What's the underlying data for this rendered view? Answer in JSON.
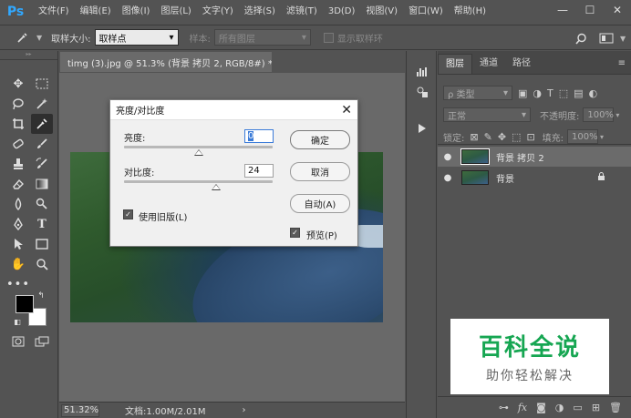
{
  "app": {
    "logo": "Ps",
    "menu": [
      "文件(F)",
      "编辑(E)",
      "图像(I)",
      "图层(L)",
      "文字(Y)",
      "选择(S)",
      "滤镜(T)",
      "3D(D)",
      "视图(V)",
      "窗口(W)",
      "帮助(H)"
    ],
    "window_controls": [
      "—",
      "☐",
      "✕"
    ]
  },
  "options_bar": {
    "sample_size_label": "取样大小:",
    "sample_size_value": "取样点",
    "sample_label": "样本:",
    "sample_value": "所有图层",
    "show_ring_label": "显示取样环"
  },
  "document": {
    "tab_title": "timg (3).jpg @ 51.3% (背景 拷贝 2, RGB/8#) *",
    "tab_close": "×",
    "zoom": "51.32%",
    "doc_info": "文档:1.00M/2.01M",
    "status_arrow": "›"
  },
  "dialog": {
    "title": "亮度/对比度",
    "close": "✕",
    "brightness_label": "亮度:",
    "brightness_value": "0",
    "brightness_level": 0.5,
    "contrast_label": "对比度:",
    "contrast_value": "24",
    "contrast_level": 0.62,
    "ok_label": "确定",
    "cancel_label": "取消",
    "auto_label": "自动(A)",
    "legacy_label": "使用旧版(L)",
    "legacy_checked": true,
    "preview_label": "预览(P)",
    "preview_checked": true,
    "check_mark": "✓"
  },
  "layers_panel": {
    "tabs": [
      "图层",
      "通道",
      "路径"
    ],
    "active_tab": 0,
    "menu_icon": "≡",
    "filter_label": "ρ 类型",
    "blend_mode": "正常",
    "opacity_label": "不透明度:",
    "opacity_value": "100%",
    "lock_label": "锁定:",
    "fill_label": "填充:",
    "fill_value": "100%",
    "layers": [
      {
        "name": "背景 拷贝 2",
        "selected": true,
        "locked": false
      },
      {
        "name": "背景",
        "selected": false,
        "locked": true
      }
    ],
    "eye_glyph": "●",
    "lock_glyph": "🔒"
  },
  "watermark": {
    "title": "百科全说",
    "subtitle": "助你轻松解决",
    "color": "#16a652"
  }
}
